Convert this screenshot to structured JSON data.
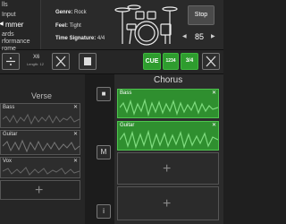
{
  "left_menu": {
    "items": [
      {
        "label": "lls"
      },
      {
        "label": "Input"
      },
      {
        "label": "mmer"
      },
      {
        "label": "ards"
      },
      {
        "label": "rformance"
      },
      {
        "label": "rome"
      },
      {
        "label": "nome"
      }
    ],
    "active_index": 2
  },
  "drummer": {
    "genre_label": "Genre:",
    "genre_value": "Rock",
    "feel_label": "Feel:",
    "feel_value": "Tight",
    "time_sig_label": "Time Signature:",
    "time_sig_value": "4/4"
  },
  "transport": {
    "stop_label": "Stop",
    "tempo": "85"
  },
  "toolbar": {
    "time_sig_top": "X6",
    "length_label": "Length:",
    "length_value": "12",
    "cue_label": "CUE",
    "count_label": "1234",
    "tempo_value": "3/4"
  },
  "verse": {
    "title": "Verse",
    "tracks": [
      {
        "name": "Bass"
      },
      {
        "name": "Guitar"
      },
      {
        "name": "Vox"
      }
    ]
  },
  "mid": {
    "stop_label": "■",
    "mute_label": "M",
    "info_label": "i"
  },
  "chorus": {
    "title": "Chorus",
    "tracks": [
      {
        "name": "Bass"
      },
      {
        "name": "Guitar"
      }
    ]
  },
  "colors": {
    "accent_green": "#2e9c2e",
    "background": "#1f1f1f"
  }
}
